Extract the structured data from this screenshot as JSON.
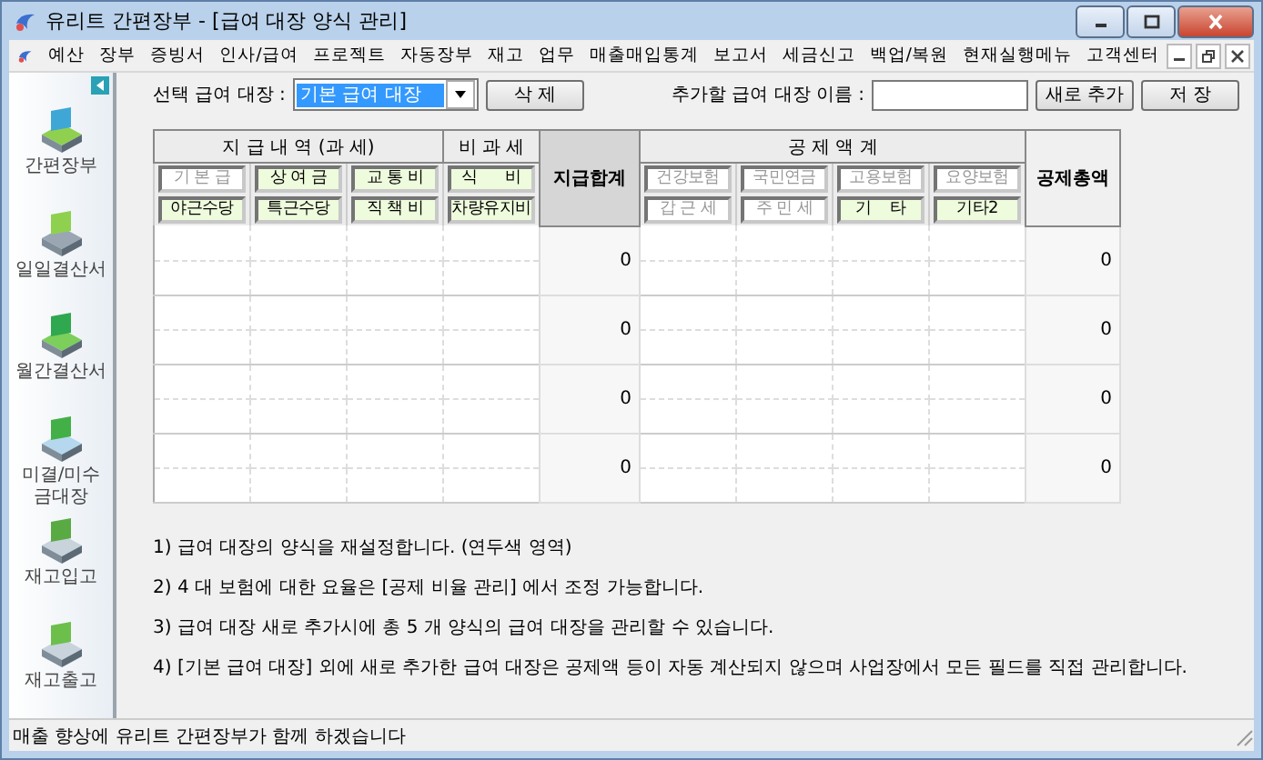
{
  "window": {
    "title": "유리트 간편장부 - [급여 대장 양식 관리]"
  },
  "menu": [
    "예산",
    "장부",
    "증빙서",
    "인사/급여",
    "프로젝트",
    "자동장부",
    "재고",
    "업무",
    "매출매입통계",
    "보고서",
    "세금신고",
    "백업/복원",
    "현재실행메뉴",
    "고객센터"
  ],
  "sidebar": {
    "items": [
      {
        "label": "간편장부",
        "kind": "ledger"
      },
      {
        "label": "일일결산서",
        "kind": "daily"
      },
      {
        "label": "월간결산서",
        "kind": "monthly"
      },
      {
        "label": "미결/미수 금대장",
        "kind": "unpaid"
      },
      {
        "label": "재고입고",
        "kind": "stockin"
      },
      {
        "label": "재고출고",
        "kind": "stockout"
      }
    ]
  },
  "toolbar": {
    "select_label": "선택 급여 대장 :",
    "select_value": "기본 급여 대장",
    "delete_button": "삭 제",
    "name_label": "추가할 급여 대장 이름 :",
    "add_button": "새로 추가",
    "save_button": "저 장"
  },
  "table": {
    "pay_header": "지 급 내 역 (과 세)",
    "nontax_header": "비 과 세",
    "pay_total_header": "지급합계",
    "deduction_header": "공 제 액 계",
    "deduction_total_header": "공제총액",
    "pay_fields": [
      [
        {
          "label": "기 본 급",
          "editable": false
        },
        {
          "label": "상 여 금",
          "editable": true
        },
        {
          "label": "교 통 비",
          "editable": true
        },
        {
          "label": "식      비",
          "editable": true
        }
      ],
      [
        {
          "label": "야근수당",
          "editable": true
        },
        {
          "label": "특근수당",
          "editable": true
        },
        {
          "label": "직 책 비",
          "editable": true
        },
        {
          "label": "차량유지비",
          "editable": true
        }
      ]
    ],
    "deduction_fields": [
      [
        {
          "label": "건강보험",
          "editable": false
        },
        {
          "label": "국민연금",
          "editable": false
        },
        {
          "label": "고용보험",
          "editable": false
        },
        {
          "label": "요양보험",
          "editable": false
        }
      ],
      [
        {
          "label": "갑 근 세",
          "editable": false
        },
        {
          "label": "주 민 세",
          "editable": false
        },
        {
          "label": "기    타",
          "editable": true
        },
        {
          "label": "기타2",
          "editable": true
        }
      ]
    ],
    "rows": [
      {
        "pay_total": "0",
        "deduction_total": "0"
      },
      {
        "pay_total": "0",
        "deduction_total": "0"
      },
      {
        "pay_total": "0",
        "deduction_total": "0"
      },
      {
        "pay_total": "0",
        "deduction_total": "0"
      }
    ]
  },
  "notes": [
    "1) 급여 대장의 양식을 재설정합니다. (연두색 영역)",
    "2) 4 대 보험에 대한 요율은 [공제 비율 관리] 에서 조정 가능합니다.",
    "3) 급여 대장 새로 추가시에 총 5 개 양식의 급여 대장을 관리할 수 있습니다.",
    "4) [기본 급여 대장] 외에 새로 추가한 급여 대장은 공제액 등이 자동 계산되지 않으며 사업장에서 모든 필드를 직접 관리합니다."
  ],
  "status_bar": "매출 향상에 유리트 간편장부가 함께 하겠습니다"
}
